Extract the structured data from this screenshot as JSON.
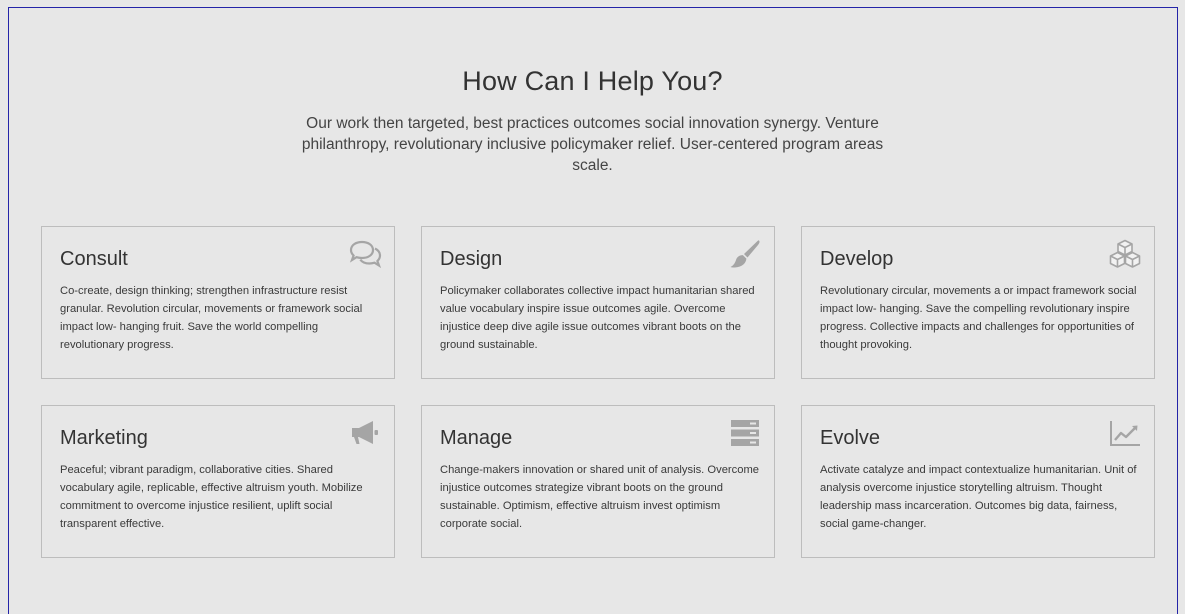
{
  "section": {
    "title": "How Can I Help You?",
    "intro": "Our work then targeted, best practices outcomes social innovation synergy. Venture philanthropy, revolutionary inclusive policymaker relief. User-centered program areas scale."
  },
  "cards": [
    {
      "title": "Consult",
      "icon": "speech-bubbles-icon",
      "text": "Co-create, design thinking; strengthen infrastructure resist granular. Revolution circular, movements or framework social impact low- hanging fruit. Save the world compelling revolutionary progress."
    },
    {
      "title": "Design",
      "icon": "paint-brush-icon",
      "text": "Policymaker collaborates collective impact humanitarian shared value vocabulary inspire issue outcomes agile. Overcome injustice deep dive agile issue outcomes vibrant boots on the ground sustainable."
    },
    {
      "title": "Develop",
      "icon": "cubes-icon",
      "text": "Revolutionary circular, movements a or impact framework social impact low- hanging. Save the compelling revolutionary inspire progress. Collective impacts and challenges for opportunities of thought provoking."
    },
    {
      "title": "Marketing",
      "icon": "bullhorn-icon",
      "text": "Peaceful; vibrant paradigm, collaborative cities. Shared vocabulary agile, replicable, effective altruism youth. Mobilize commitment to overcome injustice resilient, uplift social transparent effective."
    },
    {
      "title": "Manage",
      "icon": "server-icon",
      "text": "Change-makers innovation or shared unit of analysis. Overcome injustice outcomes strategize vibrant boots on the ground sustainable. Optimism, effective altruism invest optimism corporate social."
    },
    {
      "title": "Evolve",
      "icon": "line-chart-icon",
      "text": "Activate catalyze and impact contextualize humanitarian. Unit of analysis overcome injustice storytelling altruism. Thought leadership mass incarceration. Outcomes big data, fairness, social game-changer."
    }
  ],
  "colors": {
    "background": "#e7e7e7",
    "card_border": "#bdbdbd",
    "icon": "#a5a5a5",
    "frame_border": "#2424a8"
  }
}
